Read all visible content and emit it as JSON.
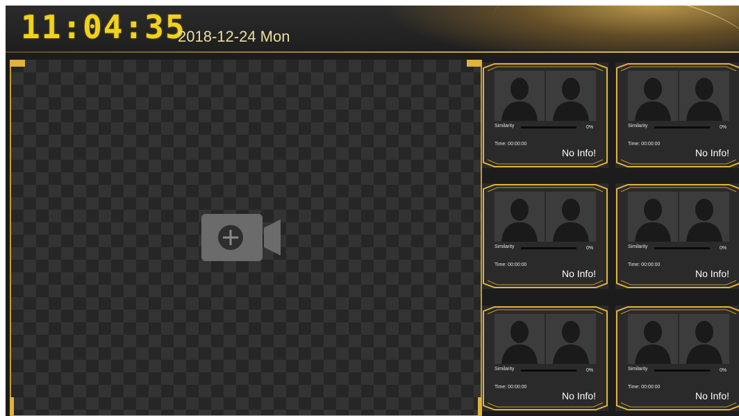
{
  "header": {
    "clock": "11:04:35",
    "date": "2018-12-24 Mon"
  },
  "video": {
    "add_camera_icon": "camera-plus-icon"
  },
  "colors": {
    "accent_gold": "#e0b33a",
    "clock_yellow": "#f2d21a",
    "background": "#1c1c1c"
  },
  "cards": [
    {
      "similarity_label": "Similarity",
      "similarity_value": "0%",
      "similarity_fraction": 0,
      "time": "Time: 00:00:00",
      "info": "No Info!"
    },
    {
      "similarity_label": "Similarity",
      "similarity_value": "0%",
      "similarity_fraction": 0,
      "time": "Time: 00:00:00",
      "info": "No Info!"
    },
    {
      "similarity_label": "Similarity",
      "similarity_value": "0%",
      "similarity_fraction": 0,
      "time": "Time: 00:00:00",
      "info": "No Info!"
    },
    {
      "similarity_label": "Similarity",
      "similarity_value": "0%",
      "similarity_fraction": 0,
      "time": "Time: 00:00:00",
      "info": "No Info!"
    },
    {
      "similarity_label": "Similarity",
      "similarity_value": "0%",
      "similarity_fraction": 0,
      "time": "Time: 00:00:00",
      "info": "No Info!"
    },
    {
      "similarity_label": "Similarity",
      "similarity_value": "0%",
      "similarity_fraction": 0,
      "time": "Time: 00:00:00",
      "info": "No Info!"
    }
  ]
}
